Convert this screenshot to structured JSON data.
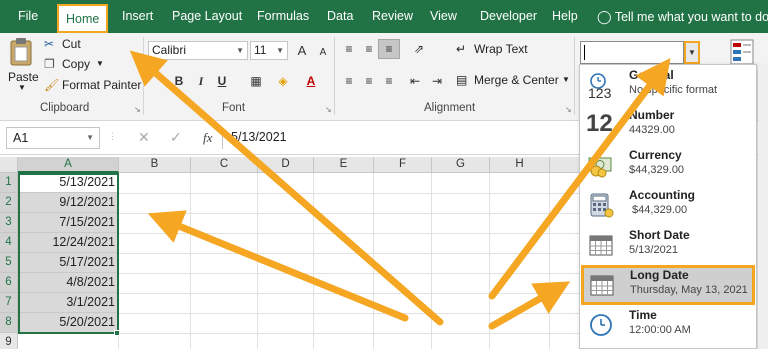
{
  "menu": {
    "file": "File",
    "home": "Home",
    "insert": "Insert",
    "page_layout": "Page Layout",
    "formulas": "Formulas",
    "data": "Data",
    "review": "Review",
    "view": "View",
    "developer": "Developer",
    "help": "Help",
    "tell_me": "Tell me what you want to do"
  },
  "clipboard": {
    "paste": "Paste",
    "cut": "Cut",
    "copy": "Copy",
    "format_painter": "Format Painter",
    "label": "Clipboard"
  },
  "font": {
    "name": "Calibri",
    "size": "11",
    "bold": "B",
    "italic": "I",
    "underline": "U",
    "grow": "A",
    "shrink": "A",
    "label": "Font"
  },
  "alignment": {
    "wrap_text": "Wrap Text",
    "merge_center": "Merge & Center",
    "label": "Alignment"
  },
  "formula_bar": {
    "name_box": "A1",
    "fx": "fx",
    "value": "5/13/2021"
  },
  "columns": [
    "A",
    "B",
    "C",
    "D",
    "E",
    "F",
    "G",
    "H"
  ],
  "rows": [
    {
      "num": "1",
      "a": "5/13/2021"
    },
    {
      "num": "2",
      "a": "9/12/2021"
    },
    {
      "num": "3",
      "a": "7/15/2021"
    },
    {
      "num": "4",
      "a": "12/24/2021"
    },
    {
      "num": "5",
      "a": "5/17/2021"
    },
    {
      "num": "6",
      "a": "4/8/2021"
    },
    {
      "num": "7",
      "a": "3/1/2021"
    },
    {
      "num": "8",
      "a": "5/20/2021"
    },
    {
      "num": "9",
      "a": ""
    }
  ],
  "number_formats": [
    {
      "name": "General",
      "example": "No specific format",
      "icon": "general-icon"
    },
    {
      "name": "Number",
      "example": "44329.00",
      "icon": "number-icon"
    },
    {
      "name": "Currency",
      "example": "$44,329.00",
      "icon": "currency-icon"
    },
    {
      "name": "Accounting",
      "example": " $44,329.00",
      "icon": "accounting-icon"
    },
    {
      "name": "Short Date",
      "example": "5/13/2021",
      "icon": "calendar-icon"
    },
    {
      "name": "Long Date",
      "example": "Thursday, May 13, 2021",
      "icon": "calendar-icon"
    },
    {
      "name": "Time",
      "example": "12:00:00 AM",
      "icon": "clock-icon"
    }
  ],
  "general_icon_text": "123",
  "number_icon_text": "12",
  "colors": {
    "excel_green": "#217346",
    "highlight_orange": "#f4a620",
    "arrow_orange": "#f5a623",
    "selection_gray": "#d9d9d9"
  }
}
